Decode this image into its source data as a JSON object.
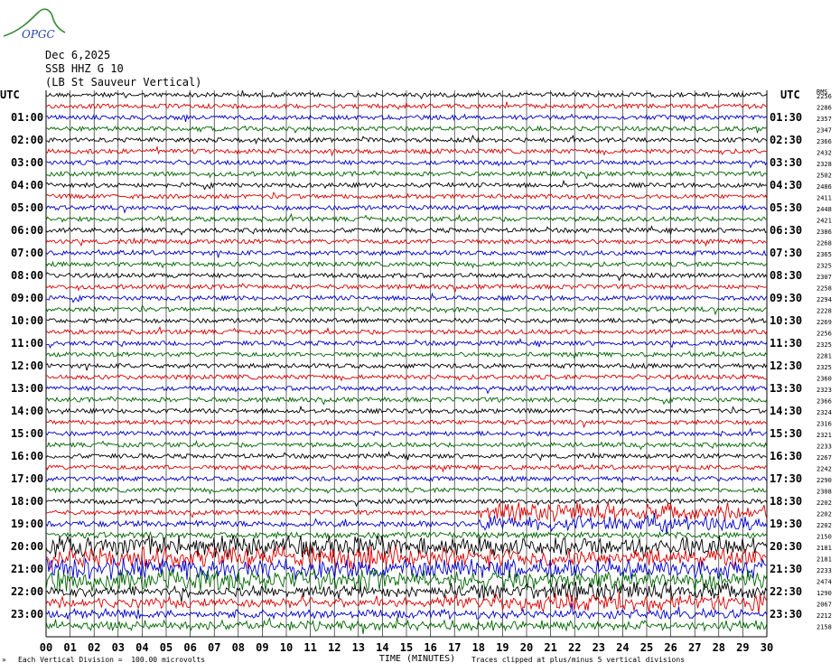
{
  "logo": {
    "text": "OPGC"
  },
  "header": {
    "date": "Dec 6,2025",
    "channel": "SSB HHZ G 10",
    "station": "(LB St Sauveur Vertical)"
  },
  "colors": {
    "trace_cycle": [
      "#000000",
      "#dd0000",
      "#0000cc",
      "#006600"
    ],
    "grid": "#000000",
    "logo_green": "#3a8a3a",
    "logo_blue": "#2244aa"
  },
  "chart_data": {
    "type": "line",
    "title": "",
    "utc_label_left": "UTC",
    "utc_label_right": "UTC",
    "right_header": "RMS",
    "left_times": [
      "01:00",
      "02:00",
      "03:00",
      "04:00",
      "05:00",
      "06:00",
      "07:00",
      "08:00",
      "09:00",
      "10:00",
      "11:00",
      "12:00",
      "13:00",
      "14:00",
      "15:00",
      "16:00",
      "17:00",
      "18:00",
      "19:00",
      "20:00",
      "21:00",
      "22:00",
      "23:00"
    ],
    "right_times": [
      "01:30",
      "02:30",
      "03:30",
      "04:30",
      "05:30",
      "06:30",
      "07:30",
      "08:30",
      "09:30",
      "10:30",
      "11:30",
      "12:30",
      "13:30",
      "14:30",
      "15:30",
      "16:30",
      "17:30",
      "18:30",
      "19:30",
      "20:30",
      "21:30",
      "22:30",
      "23:30"
    ],
    "rms_values": [
      2256,
      2286,
      2357,
      2347,
      2366,
      2432,
      2328,
      2502,
      2486,
      2411,
      2448,
      2421,
      2386,
      2268,
      2365,
      2325,
      2307,
      2258,
      2294,
      2228,
      2269,
      2256,
      2325,
      2281,
      2325,
      2360,
      2323,
      2366,
      2324,
      2316,
      2321,
      2233,
      2267,
      2242,
      2290,
      2308,
      2202,
      2202,
      2202,
      2150,
      2181,
      2181,
      2233,
      2474,
      1290,
      2067,
      2212,
      2158
    ],
    "x_ticks": [
      "00",
      "01",
      "02",
      "03",
      "04",
      "05",
      "06",
      "07",
      "08",
      "09",
      "10",
      "11",
      "12",
      "13",
      "14",
      "15",
      "16",
      "17",
      "18",
      "19",
      "20",
      "21",
      "22",
      "23",
      "24",
      "25",
      "26",
      "27",
      "28",
      "29",
      "30"
    ],
    "xlabel": "TIME (MINUTES)",
    "xlim": [
      0,
      30
    ],
    "trace_count": 48,
    "minutes_per_trace": 30,
    "grid": true
  },
  "footer": {
    "division_note": "Each Vertical Division =  100.00 microvolts",
    "clip_note": "Traces clipped at plus/minus 5 vertical divisions"
  }
}
